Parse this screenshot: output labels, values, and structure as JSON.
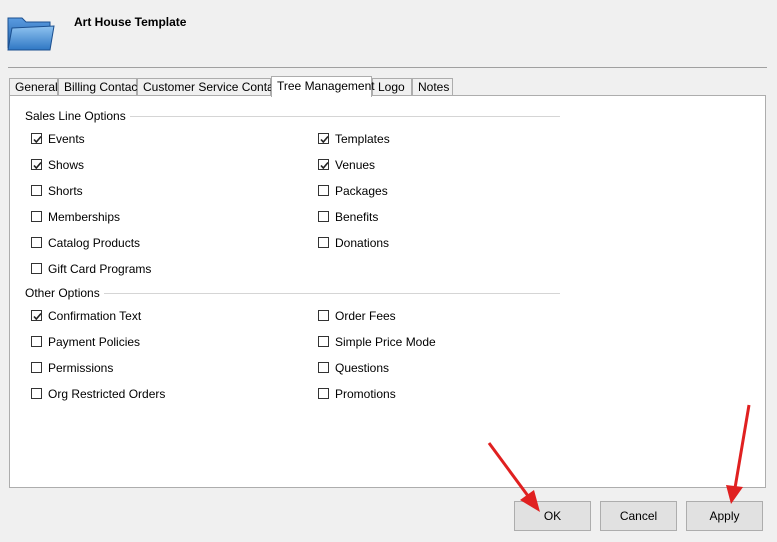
{
  "header": {
    "title": "Art House Template",
    "icon": "folder-icon"
  },
  "tabs": [
    {
      "label": "General",
      "active": false
    },
    {
      "label": "Billing Contact",
      "active": false
    },
    {
      "label": "Customer Service Contact",
      "active": false
    },
    {
      "label": "Tree Management",
      "active": true
    },
    {
      "label": "Logo",
      "active": false
    },
    {
      "label": "Notes",
      "active": false
    }
  ],
  "sales_line_options": {
    "label": "Sales Line Options",
    "left": [
      {
        "label": "Events",
        "checked": true
      },
      {
        "label": "Shows",
        "checked": true
      },
      {
        "label": "Shorts",
        "checked": false
      },
      {
        "label": "Memberships",
        "checked": false
      },
      {
        "label": "Catalog Products",
        "checked": false
      },
      {
        "label": "Gift Card Programs",
        "checked": false
      }
    ],
    "right": [
      {
        "label": "Templates",
        "checked": true
      },
      {
        "label": "Venues",
        "checked": true
      },
      {
        "label": "Packages",
        "checked": false
      },
      {
        "label": "Benefits",
        "checked": false
      },
      {
        "label": "Donations",
        "checked": false
      }
    ]
  },
  "other_options": {
    "label": "Other Options",
    "left": [
      {
        "label": "Confirmation Text",
        "checked": true
      },
      {
        "label": "Payment Policies",
        "checked": false
      },
      {
        "label": "Permissions",
        "checked": false
      },
      {
        "label": "Org Restricted Orders",
        "checked": false
      }
    ],
    "right": [
      {
        "label": "Order Fees",
        "checked": false
      },
      {
        "label": "Simple Price Mode",
        "checked": false
      },
      {
        "label": "Questions",
        "checked": false
      },
      {
        "label": "Promotions",
        "checked": false
      }
    ]
  },
  "buttons": {
    "ok": "OK",
    "cancel": "Cancel",
    "apply": "Apply"
  },
  "colors": {
    "arrow": "#e02020",
    "window_bg": "#f0f0f0",
    "panel_bg": "#ffffff"
  }
}
